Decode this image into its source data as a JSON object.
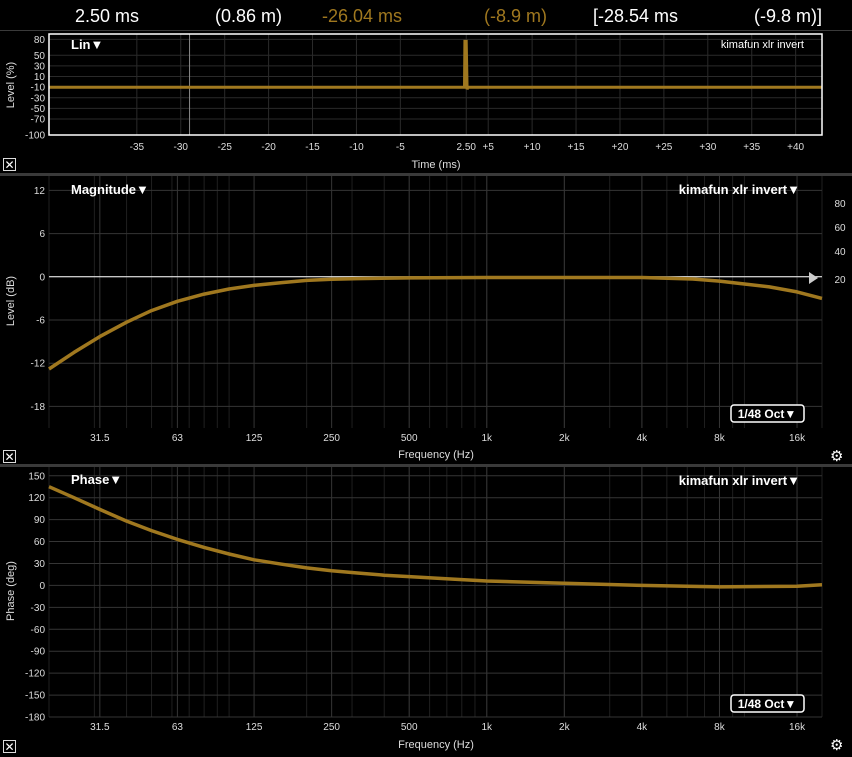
{
  "readout": {
    "cursor_time": "2.50 ms",
    "cursor_dist": "(0.86 m)",
    "delay_time": "-26.04 ms",
    "delay_dist": "(-8.9 m)",
    "diff_time": "[-28.54 ms",
    "diff_dist": "(-9.8 m)]",
    "accent_color": "#a0781f"
  },
  "impulse": {
    "mode_label": "Lin▼",
    "trace_label": "kimafun xlr invert",
    "ylabel": "Level (%)",
    "xlabel": "Time (ms)"
  },
  "magnitude": {
    "title": "Magnitude▼",
    "trace_label": "kimafun xlr invert▼",
    "ylabel": "Level (dB)",
    "xlabel": "Frequency (Hz)",
    "smoothing": "1/48 Oct▼"
  },
  "phase": {
    "title": "Phase▼",
    "trace_label": "kimafun xlr invert▼",
    "ylabel": "Phase (deg)",
    "xlabel": "Frequency (Hz)",
    "smoothing": "1/48 Oct▼"
  },
  "chart_data": [
    {
      "type": "line",
      "name": "impulse",
      "xlabel": "Time (ms)",
      "ylabel": "Level (%)",
      "xlim": [
        -45,
        43
      ],
      "ylim": [
        -100,
        90
      ],
      "xticks": [
        "-35",
        "-30",
        "-25",
        "-20",
        "-15",
        "-10",
        "-5",
        "2.50",
        "+5",
        "+10",
        "+15",
        "+20",
        "+25",
        "+30",
        "+35",
        "+40"
      ],
      "xtick_values": [
        -35,
        -30,
        -25,
        -20,
        -15,
        -10,
        -5,
        2.5,
        5,
        10,
        15,
        20,
        25,
        30,
        35,
        40
      ],
      "yticks": [
        80,
        50,
        30,
        10,
        -10,
        -30,
        -50,
        -70,
        -100
      ],
      "cursor_x": -29,
      "series": [
        {
          "x": [
            -45,
            2.3,
            2.35,
            2.5,
            2.6,
            2.7,
            43
          ],
          "y": [
            -10,
            -10,
            76,
            76,
            -14,
            -10,
            -10
          ],
          "color": "#a0781f"
        }
      ]
    },
    {
      "type": "line",
      "name": "magnitude",
      "xscale": "log",
      "xlabel": "Frequency (Hz)",
      "ylabel": "Level (dB)",
      "xlim": [
        20,
        20000
      ],
      "ylim": [
        -21,
        14
      ],
      "xticks": [
        "31.5",
        "63",
        "125",
        "250",
        "500",
        "1k",
        "2k",
        "4k",
        "8k",
        "16k"
      ],
      "xtick_values": [
        31.5,
        63,
        125,
        250,
        500,
        1000,
        2000,
        4000,
        8000,
        16000
      ],
      "yticks": [
        12,
        6,
        0,
        -6,
        -12,
        -18
      ],
      "right_yticks": [
        "80",
        "60",
        "40",
        "20"
      ],
      "reference_line": 0,
      "series": [
        {
          "x": [
            20,
            25,
            31.5,
            40,
            50,
            63,
            80,
            100,
            125,
            160,
            200,
            250,
            315,
            500,
            1000,
            2000,
            4000,
            6300,
            8000,
            10000,
            12500,
            16000,
            20000
          ],
          "y": [
            -12.8,
            -10.5,
            -8.3,
            -6.3,
            -4.7,
            -3.4,
            -2.4,
            -1.7,
            -1.2,
            -0.8,
            -0.5,
            -0.35,
            -0.25,
            -0.15,
            -0.1,
            -0.1,
            -0.1,
            -0.3,
            -0.6,
            -1.0,
            -1.4,
            -2.1,
            -3.0
          ],
          "color": "#a0781f"
        }
      ]
    },
    {
      "type": "line",
      "name": "phase",
      "xscale": "log",
      "xlabel": "Frequency (Hz)",
      "ylabel": "Phase (deg)",
      "xlim": [
        20,
        20000
      ],
      "ylim": [
        -180,
        162
      ],
      "xticks": [
        "31.5",
        "63",
        "125",
        "250",
        "500",
        "1k",
        "2k",
        "4k",
        "8k",
        "16k"
      ],
      "xtick_values": [
        31.5,
        63,
        125,
        250,
        500,
        1000,
        2000,
        4000,
        8000,
        16000
      ],
      "yticks": [
        150,
        120,
        90,
        60,
        30,
        0,
        -30,
        -60,
        -90,
        -120,
        -150,
        -180
      ],
      "series": [
        {
          "x": [
            20,
            25,
            31.5,
            40,
            50,
            63,
            80,
            100,
            125,
            160,
            200,
            250,
            315,
            400,
            500,
            630,
            800,
            1000,
            2000,
            4000,
            8000,
            16000,
            20000
          ],
          "y": [
            135,
            120,
            104,
            88,
            75,
            63,
            52,
            43,
            35,
            29,
            24,
            20,
            17,
            14,
            12,
            10,
            8,
            6,
            3,
            0,
            -2,
            -1,
            1
          ],
          "color": "#a0781f"
        }
      ]
    }
  ]
}
